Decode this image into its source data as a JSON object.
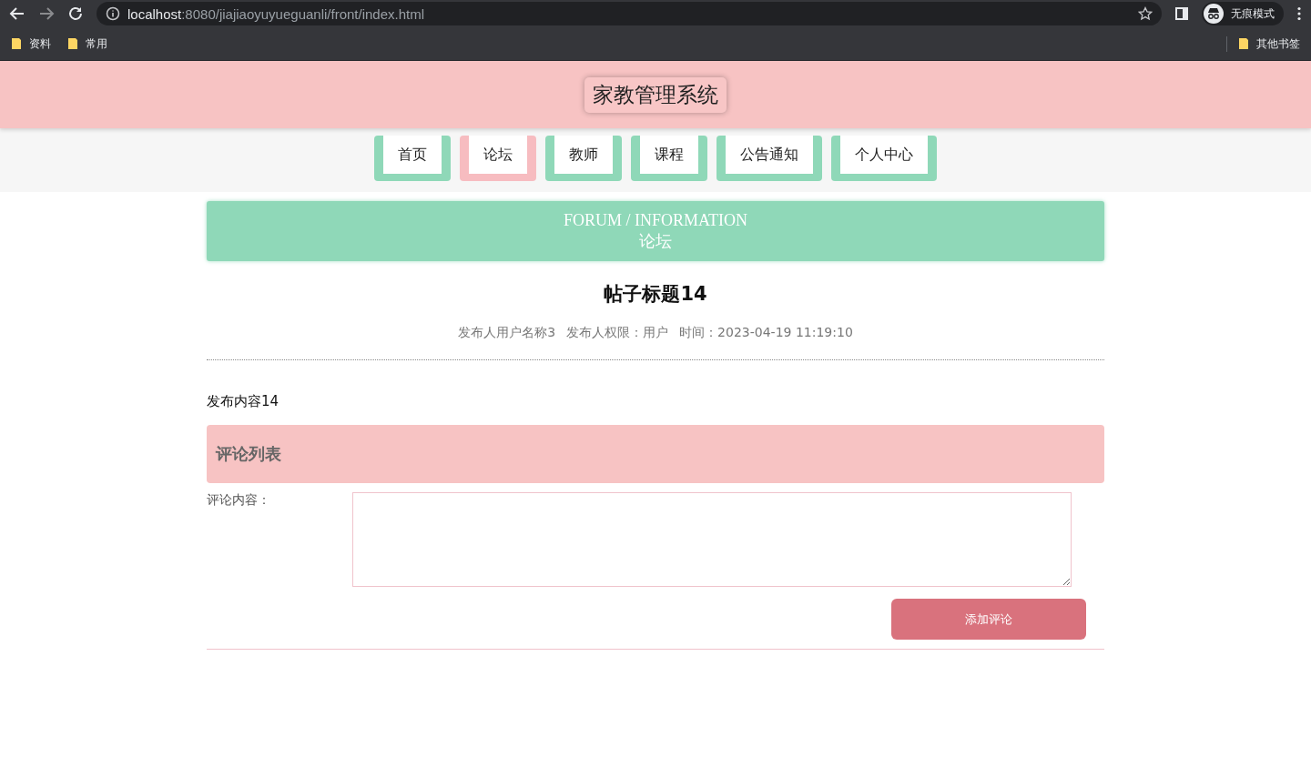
{
  "browser": {
    "url_host": "localhost",
    "url_path": ":8080/jiajiaoyuyueguanli/front/index.html",
    "incognito_label": "无痕模式",
    "bookmarks": [
      "资料",
      "常用"
    ],
    "other_bookmarks": "其他书签"
  },
  "site_title": "家教管理系统",
  "nav": [
    {
      "label": "首页",
      "selected": false
    },
    {
      "label": "论坛",
      "selected": true
    },
    {
      "label": "教师",
      "selected": false
    },
    {
      "label": "课程",
      "selected": false
    },
    {
      "label": "公告通知",
      "selected": false
    },
    {
      "label": "个人中心",
      "selected": false
    }
  ],
  "banner": {
    "english": "FORUM / INFORMATION",
    "chinese": "论坛"
  },
  "post": {
    "title": "帖子标题14",
    "author": "发布人用户名称3",
    "role": "发布人权限：用户",
    "time": "时间：2023-04-19 11:19:10",
    "content": "发布内容14"
  },
  "comments": {
    "heading": "评论列表",
    "field_label": "评论内容：",
    "submit": "添加评论"
  }
}
